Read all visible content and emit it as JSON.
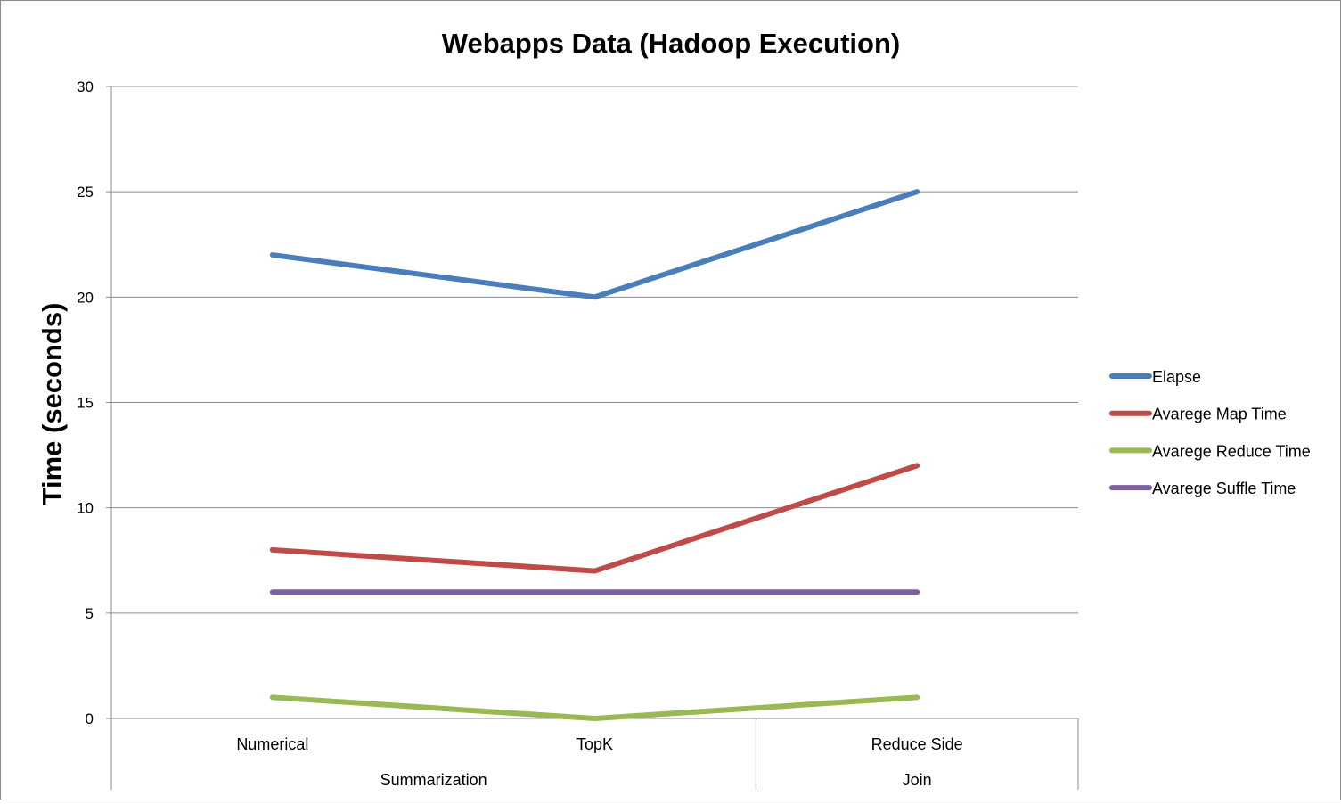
{
  "chart_data": {
    "type": "line",
    "title": "Webapps Data (Hadoop Execution)",
    "ylabel": "Time (seconds)",
    "xlabel": "",
    "ylim": [
      0,
      30
    ],
    "yticks": [
      0,
      5,
      10,
      15,
      20,
      25,
      30
    ],
    "grid": true,
    "legend_position": "right",
    "categories": [
      "Numerical",
      "TopK",
      "Reduce Side"
    ],
    "category_groups": [
      {
        "label": "Summarization",
        "span": 2
      },
      {
        "label": "Join",
        "span": 1
      }
    ],
    "series": [
      {
        "name": "Elapse",
        "color": "#4a7ebb",
        "values": [
          22,
          20,
          25
        ]
      },
      {
        "name": "Avarege Map Time",
        "color": "#be4b48",
        "values": [
          8,
          7,
          12
        ]
      },
      {
        "name": "Avarege Reduce Time",
        "color": "#98b954",
        "values": [
          1,
          0,
          1
        ]
      },
      {
        "name": "Avarege Suffle Time",
        "color": "#7d60a0",
        "values": [
          6,
          6,
          6
        ]
      }
    ]
  }
}
